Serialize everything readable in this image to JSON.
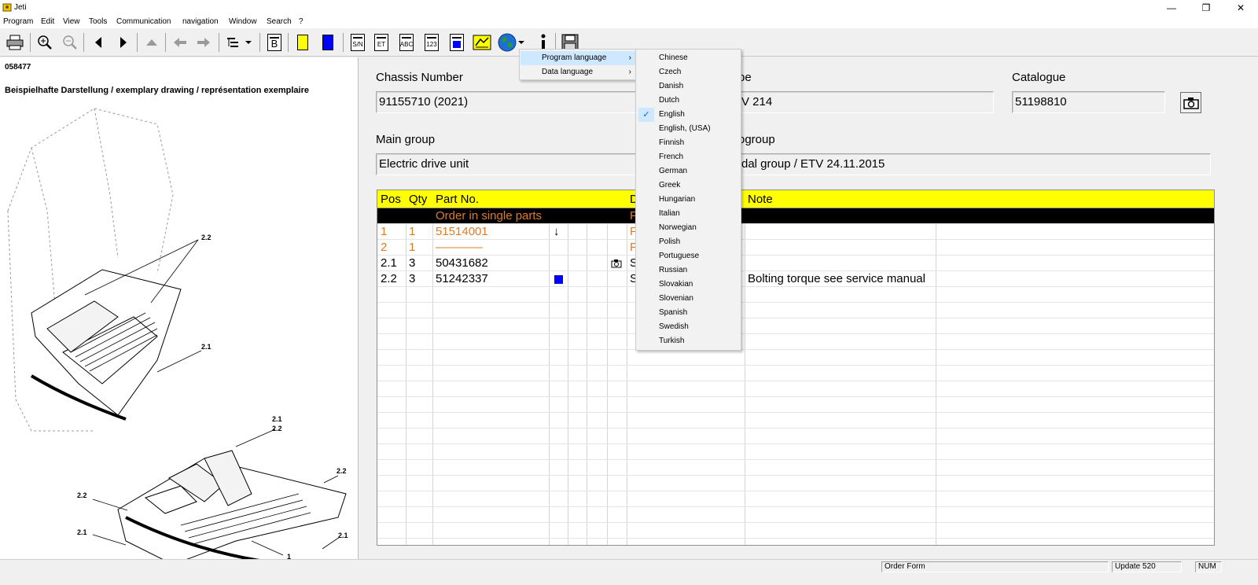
{
  "window": {
    "title": "Jeti",
    "minimize": "—",
    "restore": "❐",
    "close": "✕"
  },
  "menu": [
    "Program",
    "Edit",
    "View",
    "Tools",
    "Communication",
    "navigation",
    "Window",
    "Search",
    "?"
  ],
  "toolbar": {
    "doc_buttons": [
      "S/N",
      "ET",
      "ABC",
      "123"
    ],
    "b_button": "B",
    "colors": {
      "yellow": "#ffff00",
      "blue": "#0000ff"
    }
  },
  "left": {
    "code": "058477",
    "caption": "Beispielhafte Darstellung / exemplary drawing / représentation exemplaire",
    "callouts": [
      "2.2",
      "2.1",
      "2.1",
      "2.2",
      "2.2",
      "2.2",
      "2.1",
      "2.1",
      "1"
    ]
  },
  "header": {
    "chassis_label": "Chassis Number",
    "chassis_value": "91155710  (2021)",
    "type_label": "pe",
    "type_value": "V 214",
    "catalogue_label": "Catalogue",
    "catalogue_value": "51198810",
    "main_group_label": "Main group",
    "main_group_value": "Electric drive unit",
    "subgroup_label": "ogroup",
    "subgroup_value": "dal group / ETV 24.11.2015"
  },
  "grid": {
    "headers": {
      "pos": "Pos",
      "qty": "Qty",
      "part": "Part No.",
      "desc": "D",
      "note": "Note"
    },
    "section_row": {
      "part": "Order in single parts",
      "desc": "F"
    },
    "rows": [
      {
        "pos": "1",
        "qty": "1",
        "part": "51514001",
        "mark": "↓",
        "desc": "F",
        "note": ""
      },
      {
        "pos": "2",
        "qty": "1",
        "part": "————",
        "mark": "",
        "desc": "F",
        "note": ""
      },
      {
        "pos": "2.1",
        "qty": "3",
        "part": "50431682",
        "mark": "",
        "desc": "S",
        "note": ""
      },
      {
        "pos": "2.2",
        "qty": "3",
        "part": "51242337",
        "mark": "",
        "desc": "S",
        "note": "Bolting torque see service manual"
      }
    ]
  },
  "language_menu": {
    "items": [
      "Program language",
      "Data language"
    ],
    "arrow": "›",
    "languages": [
      "Chinese",
      "Czech",
      "Danish",
      "Dutch",
      "English",
      "English, (USA)",
      "Finnish",
      "French",
      "German",
      "Greek",
      "Hungarian",
      "Italian",
      "Norwegian",
      "Polish",
      "Portuguese",
      "Russian",
      "Slovakian",
      "Slovenian",
      "Spanish",
      "Swedish",
      "Turkish"
    ],
    "selected": "English",
    "check": "✓"
  },
  "status": {
    "order_form": "Order Form",
    "update": "Update 520",
    "num": "NUM"
  }
}
